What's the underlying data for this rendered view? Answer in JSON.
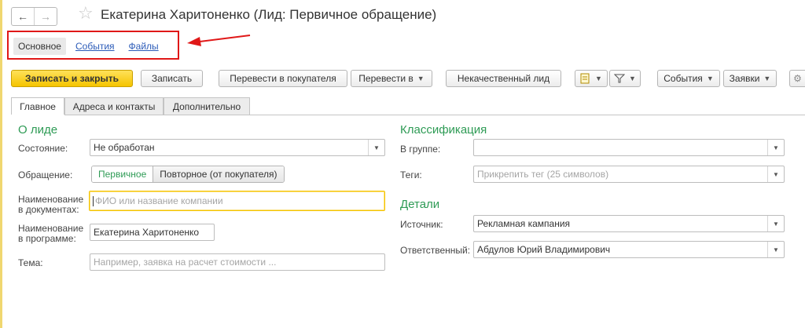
{
  "window": {
    "title": "Екатерина Харитоненко (Лид: Первичное обращение)",
    "back_icon": "←",
    "forward_icon": "→",
    "star_icon": "☆"
  },
  "nav_tabs": {
    "main": "Основное",
    "events": "События",
    "files": "Файлы"
  },
  "toolbar": {
    "save_close": "Записать и закрыть",
    "save": "Записать",
    "to_customer": "Перевести в покупателя",
    "convert_to": "Перевести в",
    "low_quality": "Некачественный лид",
    "events": "События",
    "requests": "Заявки"
  },
  "form_tabs": {
    "main": "Главное",
    "addresses": "Адреса и контакты",
    "extra": "Дополнительно"
  },
  "about": {
    "section": "О лиде",
    "state_label": "Состояние:",
    "state_value": "Не обработан",
    "appeal_label": "Обращение:",
    "appeal_primary": "Первичное",
    "appeal_repeat": "Повторное (от покупателя)",
    "docname_label_1": "Наименование",
    "docname_label_2": "в документах:",
    "docname_placeholder": "ФИО или название компании",
    "progname_label_1": "Наименование",
    "progname_label_2": "в программе:",
    "progname_value": "Екатерина Харитоненко",
    "topic_label": "Тема:",
    "topic_placeholder": "Например, заявка на расчет стоимости ..."
  },
  "classification": {
    "section": "Классификация",
    "group_label": "В группе:",
    "group_value": "",
    "tags_label": "Теги:",
    "tags_placeholder": "Прикрепить тег (25 символов)"
  },
  "details": {
    "section": "Детали",
    "source_label": "Источник:",
    "source_value": "Рекламная кампания",
    "responsible_label": "Ответственный:",
    "responsible_value": "Абдулов Юрий Владимирович"
  },
  "colors": {
    "primary_button": "#f5c400",
    "section_heading": "#2e9b55",
    "link": "#2b5bb8",
    "highlight": "#e01818"
  }
}
